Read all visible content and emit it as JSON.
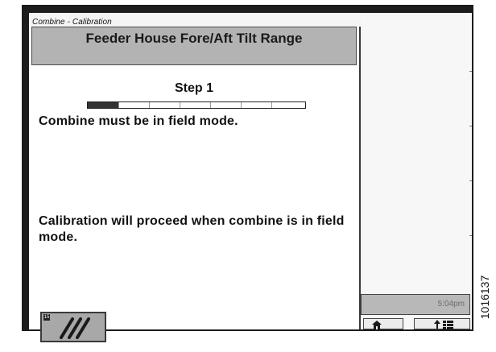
{
  "window": {
    "title": "Combine - Calibration"
  },
  "header": {
    "title": "Feeder House Fore/Aft Tilt Range"
  },
  "step": {
    "label": "Step 1",
    "progress": 0.14
  },
  "messages": {
    "primary": "Combine must be in field mode.",
    "secondary": "Calibration will proceed when combine is in field mode."
  },
  "exit_button": {
    "badge": "15",
    "icon": "slashes-icon"
  },
  "status": {
    "time": "5:04pm"
  },
  "nav": {
    "home_icon": "home-icon",
    "menu_icon": "up-arrow-menu-icon"
  },
  "figure": {
    "number": "1016137"
  }
}
